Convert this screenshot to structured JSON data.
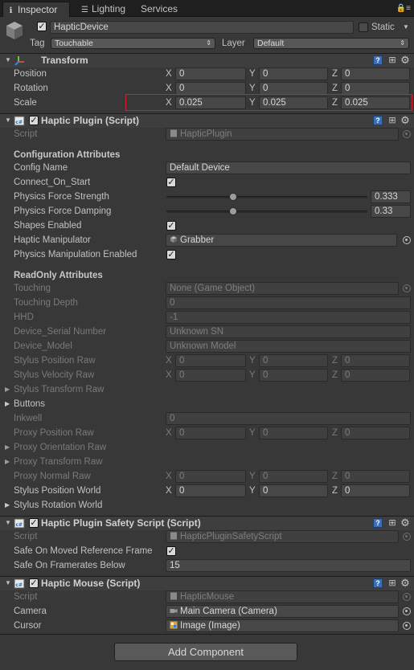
{
  "tabs": [
    {
      "label": "Inspector",
      "icon": "info-icon"
    },
    {
      "label": "Lighting",
      "icon": "lighting-icon"
    },
    {
      "label": "Services",
      "icon": ""
    }
  ],
  "object": {
    "name": "HapticDevice",
    "static_label": "Static",
    "tag_label": "Tag",
    "tag_value": "Touchable",
    "layer_label": "Layer",
    "layer_value": "Default"
  },
  "transform": {
    "title": "Transform",
    "rows": [
      {
        "label": "Position",
        "x": "0",
        "y": "0",
        "z": "0"
      },
      {
        "label": "Rotation",
        "x": "0",
        "y": "0",
        "z": "0"
      },
      {
        "label": "Scale",
        "x": "0.025",
        "y": "0.025",
        "z": "0.025"
      }
    ]
  },
  "axes": {
    "x": "X",
    "y": "Y",
    "z": "Z"
  },
  "haptic_plugin": {
    "title": "Haptic Plugin (Script)",
    "script_label": "Script",
    "script_value": "HapticPlugin",
    "config_header": "Configuration Attributes",
    "config_name_label": "Config Name",
    "config_name_value": "Default Device",
    "connect_label": "Connect_On_Start",
    "force_strength_label": "Physics Force Strength",
    "force_strength_value": "0.333",
    "force_strength_fraction": 0.333,
    "force_damping_label": "Physics Force Damping",
    "force_damping_value": "0.33",
    "force_damping_fraction": 0.33,
    "shapes_label": "Shapes Enabled",
    "manipulator_label": "Haptic Manipulator",
    "manipulator_value": "Grabber",
    "phys_manip_label": "Physics Manipulation Enabled",
    "readonly_header": "ReadOnly Attributes",
    "touching_label": "Touching",
    "touching_value": "None (Game Object)",
    "touching_depth_label": "Touching Depth",
    "touching_depth_value": "0",
    "hhd_label": "HHD",
    "hhd_value": "-1",
    "serial_label": "Device_Serial Number",
    "serial_value": "Unknown SN",
    "model_label": "Device_Model",
    "model_value": "Unknown Model",
    "stylus_pos_raw_label": "Stylus Position Raw",
    "stylus_vel_raw_label": "Stylus Velocity Raw",
    "stylus_transform_raw_label": "Stylus Transform Raw",
    "buttons_label": "Buttons",
    "inkwell_label": "Inkwell",
    "inkwell_value": "0",
    "proxy_pos_raw_label": "Proxy Position Raw",
    "proxy_orient_raw_label": "Proxy Orientation Raw",
    "proxy_transform_raw_label": "Proxy Transform Raw",
    "proxy_normal_raw_label": "Proxy Normal Raw",
    "stylus_pos_world_label": "Stylus Position World",
    "stylus_rot_world_label": "Stylus Rotation World",
    "zero": "0"
  },
  "safety": {
    "title": "Haptic Plugin Safety Script (Script)",
    "script_label": "Script",
    "script_value": "HapticPluginSafetyScript",
    "moved_label": "Safe On Moved Reference Frame",
    "framerate_label": "Safe On Framerates Below",
    "framerate_value": "15"
  },
  "mouse": {
    "title": "Haptic Mouse (Script)",
    "script_label": "Script",
    "script_value": "HapticMouse",
    "camera_label": "Camera",
    "camera_value": "Main Camera (Camera)",
    "cursor_label": "Cursor",
    "cursor_value": "Image (Image)"
  },
  "add_component_label": "Add Component",
  "colors": {
    "background": "#383838",
    "highlight": "#d0202a",
    "field": "#474747",
    "book_icon": "#3a6fb5"
  }
}
